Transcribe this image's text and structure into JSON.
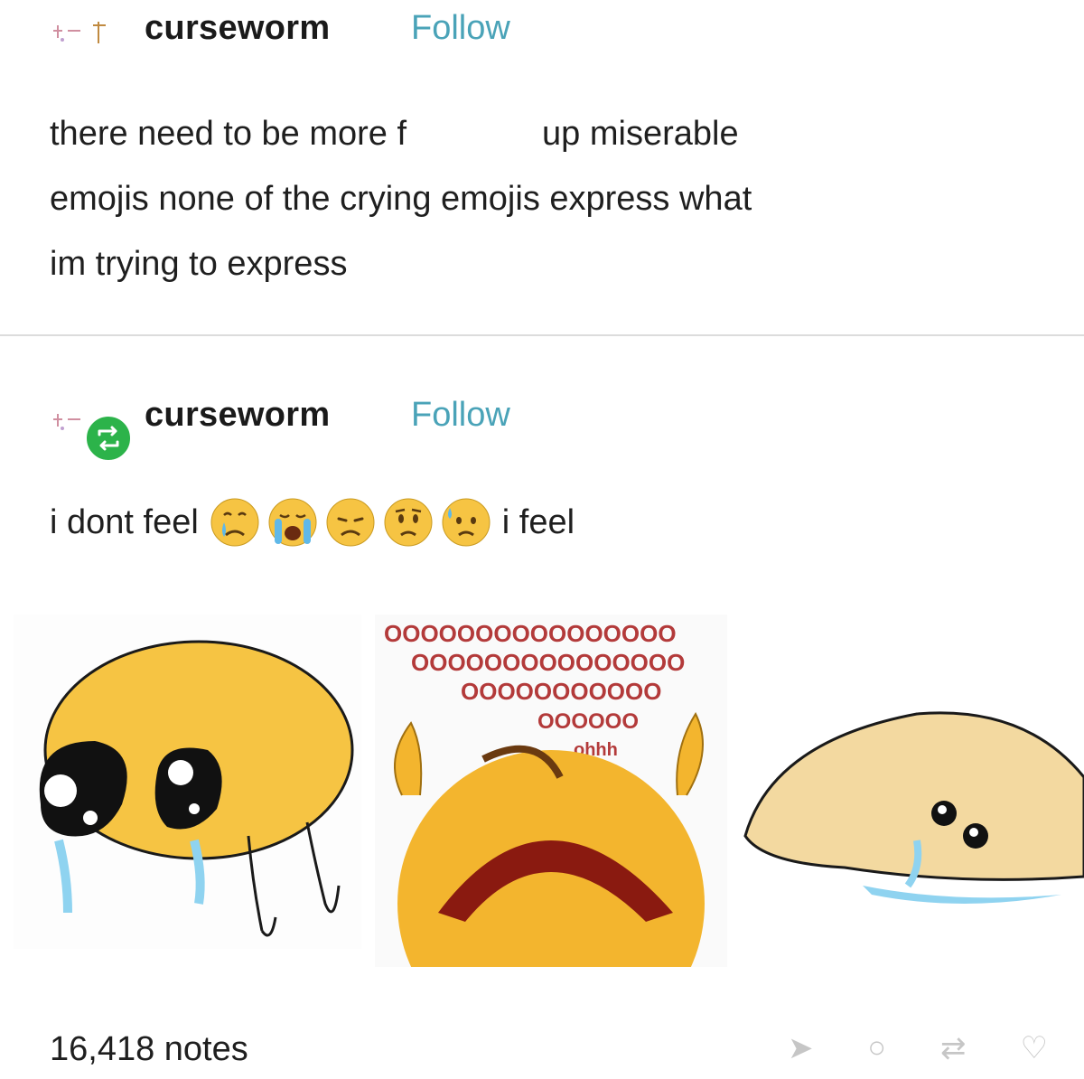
{
  "post1": {
    "username": "curseworm",
    "follow_label": "Follow",
    "text_part1": "there need to be more f",
    "text_part2": "up miserable",
    "text_line2": "emojis none of the crying emojis express what",
    "text_line3": "im trying to express"
  },
  "post2": {
    "username": "curseworm",
    "follow_label": "Follow",
    "text_before": "i dont feel",
    "emojis": [
      "crying-face",
      "loudly-crying-face",
      "disappointed-face",
      "worried-face",
      "sad-sweat-face"
    ],
    "text_after": "i feel"
  },
  "footer": {
    "notes": "16,418 notes"
  },
  "images": [
    {
      "name": "crying-worm-emoji"
    },
    {
      "name": "wailing-emoji-ooo"
    },
    {
      "name": "melted-puddle-emoji"
    }
  ],
  "meme_text": {
    "line1": "OOOOOOOOOOOOOOOO",
    "line2": "OOOOOOOOOOOOOOO",
    "line3": "OOOOOOOOOOO",
    "line4": "OOOOOO",
    "line5": "ohhh"
  },
  "colors": {
    "follow": "#4aa3b8",
    "reblog": "#2cb34a",
    "emoji_yellow": "#f6c443",
    "puddle": "#f3d9a0",
    "tear": "#8fd3f0"
  }
}
